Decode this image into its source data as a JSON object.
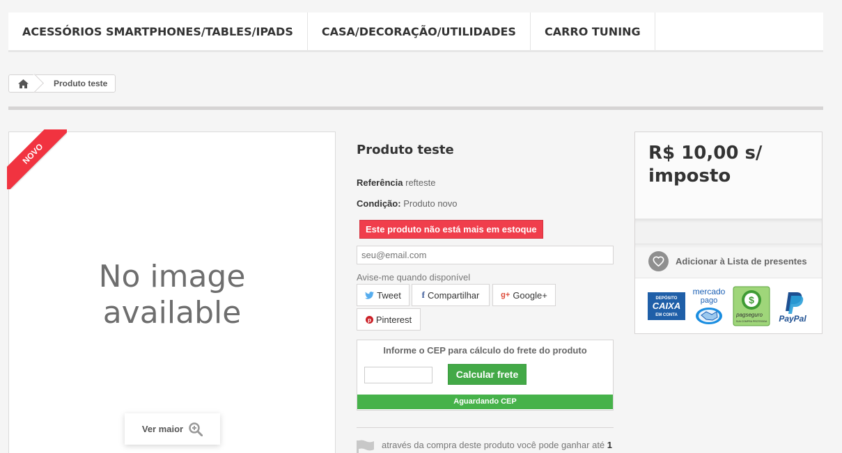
{
  "menu": {
    "items": [
      {
        "label": "ACESSÓRIOS SMARTPHONES/TABLES/IPADS"
      },
      {
        "label": "CASA/DECORAÇÃO/UTILIDADES"
      },
      {
        "label": "CARRO TUNING"
      }
    ]
  },
  "breadcrumb": {
    "home_icon": "home-icon",
    "current": "Produto teste"
  },
  "image": {
    "badge": "NOVO",
    "placeholder_line1": "No image",
    "placeholder_line2": "available",
    "view_larger": "Ver maior"
  },
  "product": {
    "title": "Produto teste",
    "reference_label": "Referência",
    "reference_value": "refteste",
    "condition_label": "Condição:",
    "condition_value": "Produto novo",
    "stock_alert": "Este produto não está mais em estoque",
    "email_placeholder": "seu@email.com",
    "notify_text": "Avise-me quando disponível"
  },
  "social": {
    "tweet": "Tweet",
    "share": "Compartilhar",
    "google": "Google+",
    "pinterest": "Pinterest"
  },
  "shipping": {
    "title": "Informe o CEP para cálculo do frete do produto",
    "button": "Calcular frete",
    "status": "Aguardando CEP"
  },
  "loyalty": {
    "text": "através da compra deste produto você pode ganhar até",
    "amount": "1"
  },
  "pricebox": {
    "price_line1": "R$ 10,00 s/",
    "price_line2": "imposto",
    "wishlist": "Adicionar à Lista de presentes"
  },
  "payment_logos": {
    "caixa_top": "DEPÓSITO",
    "caixa_mid": "CAIXA",
    "caixa_bottom": "EM CONTA",
    "mercado_1": "mercado",
    "mercado_2": "pago",
    "pagseguro": "pagseguro",
    "pagseguro_sub": "SUA COMPRA PROTEGIDA",
    "paypal": "PayPal"
  },
  "colors": {
    "accent_red": "#f03e4c",
    "accent_green": "#43a947",
    "caixa_blue": "#1f5fa8",
    "paypal_blue": "#1d4f91"
  }
}
